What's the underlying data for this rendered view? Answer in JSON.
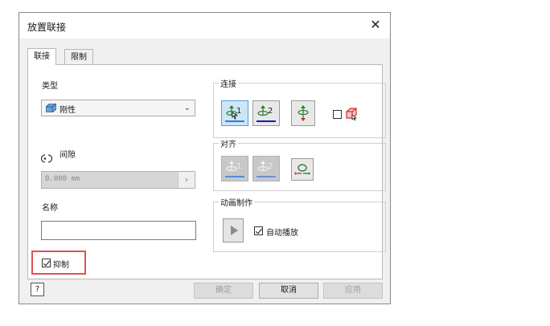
{
  "dialog": {
    "title": "放置联接",
    "close_symbol": "✕"
  },
  "tabs": [
    {
      "label": "联接",
      "active": true
    },
    {
      "label": "限制",
      "active": false
    }
  ],
  "left": {
    "type_label": "类型",
    "type_value": "刚性",
    "type_icon": "rigid-joint-icon",
    "gap_label": "间隙",
    "gap_icon": "gap-icon",
    "gap_value": "0.000 mm",
    "name_label": "名称",
    "name_value": "",
    "lock_label": "抑制",
    "lock_checked": true
  },
  "connect": {
    "legend": "连接",
    "btn1_label": "1",
    "btn2_label": "2",
    "btn1_underline": "#2c7fd4",
    "btn2_underline": "#1a1aaa",
    "flip_icon": "flip-icon",
    "checkbox_checked": false,
    "cube_icon": "red-cube-select-icon"
  },
  "align": {
    "legend": "对齐",
    "btn1_label": "1",
    "btn2_label": "2",
    "flip_icon": "align-flip-icon"
  },
  "animate": {
    "legend": "动画制作",
    "play_icon": "play-icon",
    "autoplay_label": "自动播放",
    "autoplay_checked": true
  },
  "footer": {
    "help_icon": "help-icon",
    "help_symbol": "?",
    "ok_label": "确定",
    "cancel_label": "取消",
    "apply_label": "应用"
  },
  "colors": {
    "highlight_border": "#e05050",
    "pressed_bg": "#cde6f7"
  }
}
